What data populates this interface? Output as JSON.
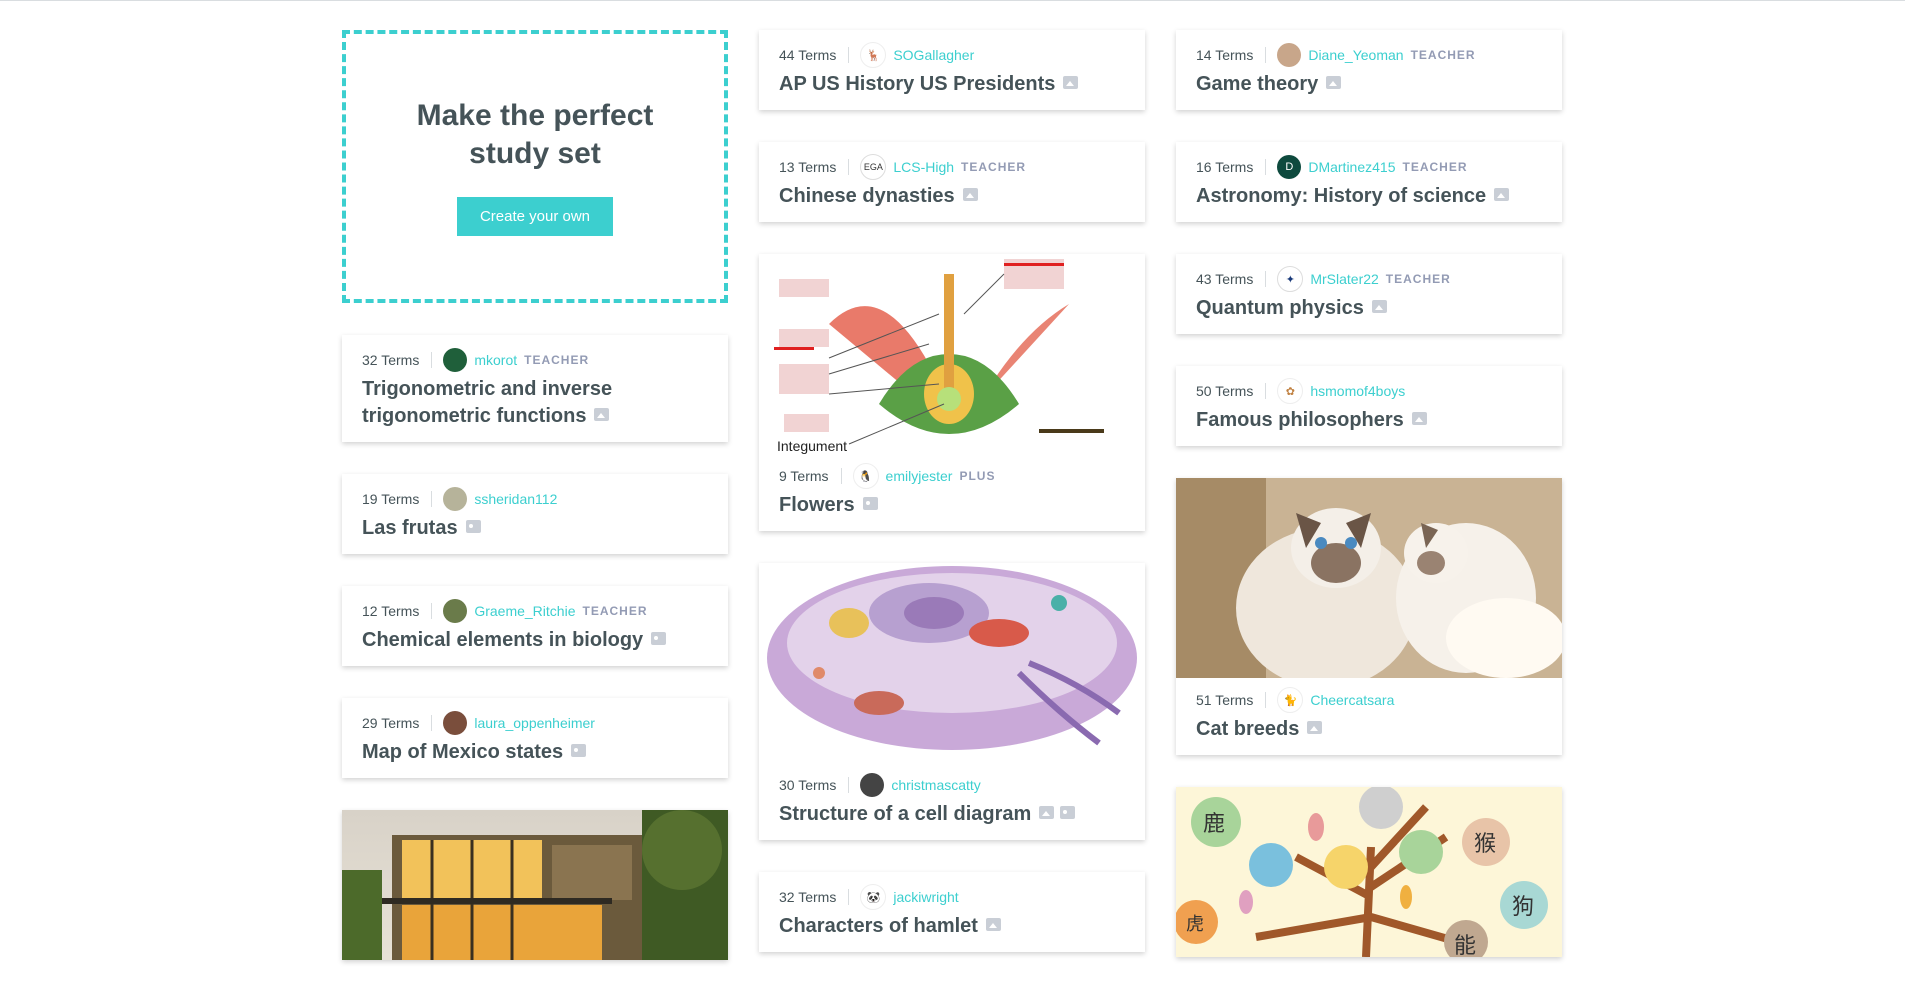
{
  "create": {
    "heading": "Make the perfect study set",
    "button": "Create your own"
  },
  "sets": {
    "trig": {
      "terms": "32 Terms",
      "user": "mkorot",
      "badge": "TEACHER",
      "title": "Trigonometric and inverse trigonometric functions"
    },
    "frutas": {
      "terms": "19 Terms",
      "user": "ssheridan112",
      "badge": "",
      "title": "Las frutas"
    },
    "chem": {
      "terms": "12 Terms",
      "user": "Graeme_Ritchie",
      "badge": "TEACHER",
      "title": "Chemical elements in biology"
    },
    "mexico": {
      "terms": "29 Terms",
      "user": "laura_oppenheimer",
      "badge": "",
      "title": "Map of Mexico states"
    },
    "apus": {
      "terms": "44 Terms",
      "user": "SOGallagher",
      "badge": "",
      "title": "AP US History US Presidents"
    },
    "china": {
      "terms": "13 Terms",
      "user": "LCS-High",
      "badge": "TEACHER",
      "title": "Chinese dynasties"
    },
    "flowers": {
      "terms": "9 Terms",
      "user": "emilyjester",
      "badge": "PLUS",
      "title": "Flowers",
      "diagram_label": "Integument"
    },
    "cell": {
      "terms": "30 Terms",
      "user": "christmascatty",
      "badge": "",
      "title": "Structure of a cell diagram"
    },
    "hamlet": {
      "terms": "32 Terms",
      "user": "jackiwright",
      "badge": "",
      "title": "Characters of hamlet"
    },
    "game": {
      "terms": "14 Terms",
      "user": "Diane_Yeoman",
      "badge": "TEACHER",
      "title": "Game theory"
    },
    "astro": {
      "terms": "16 Terms",
      "user": "DMartinez415",
      "badge": "TEACHER",
      "title": "Astronomy: History of science",
      "avatar_letter": "D"
    },
    "quantum": {
      "terms": "43 Terms",
      "user": "MrSlater22",
      "badge": "TEACHER",
      "title": "Quantum physics"
    },
    "philo": {
      "terms": "50 Terms",
      "user": "hsmomof4boys",
      "badge": "",
      "title": "Famous philosophers"
    },
    "cats": {
      "terms": "51 Terms",
      "user": "Cheercatsara",
      "badge": "",
      "title": "Cat breeds"
    }
  },
  "zodiac_chars": [
    "鹿",
    "猴",
    "虎",
    "狗",
    "能"
  ],
  "colors": {
    "accent": "#3ccfcf",
    "text": "#455358",
    "badge": "#939bb4",
    "icon": "#c9ced6"
  }
}
